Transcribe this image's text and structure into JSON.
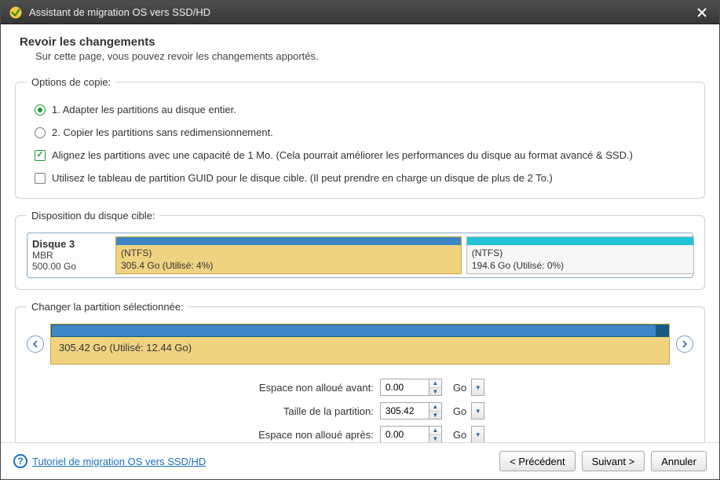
{
  "window": {
    "title": "Assistant de migration OS vers SSD/HD"
  },
  "header": {
    "title": "Revoir les changements",
    "description": "Sur cette page, vous pouvez revoir les changements apportés."
  },
  "options": {
    "legend": "Options de copie:",
    "radio1": "1. Adapter les partitions au disque entier.",
    "radio2": "2. Copier les partitions sans redimensionnement.",
    "check1": "Alignez les partitions avec une capacité de 1 Mo. (Cela pourrait améliorer les performances du disque au format avancé & SSD.)",
    "check2": "Utilisez le tableau de partition GUID pour le disque cible. (Il peut prendre en charge un disque de plus de 2 To.)"
  },
  "layout": {
    "legend": "Disposition du disque cible:",
    "disk": {
      "name": "Disque 3",
      "scheme": "MBR",
      "size": "500.00 Go"
    },
    "partitions": [
      {
        "fs": "(NTFS)",
        "meta": "305.4 Go (Utilisé: 4%)",
        "width_pct": 60.3,
        "fill_pct": 100,
        "fill_color": "#3d87c6"
      },
      {
        "fs": "(NTFS)",
        "meta": "194.6 Go (Utilisé: 0%)",
        "width_pct": 39.7,
        "fill_pct": 100,
        "fill_color": "#1fc4d6"
      }
    ]
  },
  "change": {
    "legend": "Changer la partition sélectionnée:",
    "meta": "305.42 Go (Utilisé: 12.44 Go)",
    "fill_pct": 98
  },
  "form": {
    "before_label": "Espace non alloué avant:",
    "before_value": "0.00",
    "size_label": "Taille de la partition:",
    "size_value": "305.42",
    "after_label": "Espace non alloué après:",
    "after_value": "0.00",
    "unit": "Go"
  },
  "footer": {
    "tutorial": "Tutoriel de migration OS vers SSD/HD",
    "back": "< Précédent",
    "next": "Suivant >",
    "cancel": "Annuler"
  }
}
